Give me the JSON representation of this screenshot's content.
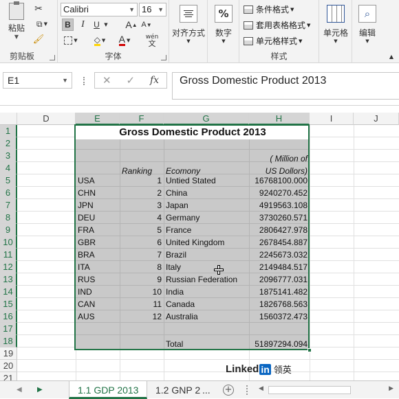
{
  "ribbon": {
    "clipboard": {
      "paste_label": "粘贴",
      "group_label": "剪贴板"
    },
    "font": {
      "font_name": "Calibri",
      "font_size": "16",
      "bold": "B",
      "italic": "I",
      "underline": "U",
      "grow": "A",
      "shrink": "A",
      "font_color": "A",
      "wen": "wén",
      "wen_sub": "文",
      "group_label": "字体"
    },
    "alignment": {
      "label": "对齐方式"
    },
    "number": {
      "label": "数字",
      "icon": "%"
    },
    "styles": {
      "conditional": "条件格式",
      "table": "套用表格格式",
      "cell_styles": "单元格样式",
      "group_label": "样式"
    },
    "cells": {
      "label": "单元格"
    },
    "editing": {
      "label": "编辑"
    }
  },
  "formula_bar": {
    "name_box": "E1",
    "cancel": "✕",
    "enter": "✓",
    "fx": "fx",
    "content": "Gross Domestic Product 2013"
  },
  "columns": [
    "D",
    "E",
    "F",
    "G",
    "H",
    "I",
    "J"
  ],
  "rows": [
    "1",
    "2",
    "3",
    "4",
    "5",
    "6",
    "7",
    "8",
    "9",
    "10",
    "11",
    "12",
    "13",
    "14",
    "15",
    "16",
    "17",
    "18",
    "19",
    "20",
    "21"
  ],
  "sheet": {
    "title": "Gross Domestic Product 2013",
    "unit_line1": "( Million of",
    "unit_line2": "US Dollors)",
    "header_ranking": "Ranking",
    "header_economy": "Ecomony",
    "data": [
      {
        "code": "USA",
        "rank": "1",
        "name": "Untied Stated",
        "value": "16768100.000"
      },
      {
        "code": "CHN",
        "rank": "2",
        "name": "China",
        "value": "9240270.452"
      },
      {
        "code": "JPN",
        "rank": "3",
        "name": "Japan",
        "value": "4919563.108"
      },
      {
        "code": "DEU",
        "rank": "4",
        "name": "Germany",
        "value": "3730260.571"
      },
      {
        "code": "FRA",
        "rank": "5",
        "name": "France",
        "value": "2806427.978"
      },
      {
        "code": "GBR",
        "rank": "6",
        "name": "United Kingdom",
        "value": "2678454.887"
      },
      {
        "code": "BRA",
        "rank": "7",
        "name": "Brazil",
        "value": "2245673.032"
      },
      {
        "code": "ITA",
        "rank": "8",
        "name": "Italy",
        "value": "2149484.517"
      },
      {
        "code": "RUS",
        "rank": "9",
        "name": "Russian Federation",
        "value": "2096777.031"
      },
      {
        "code": "IND",
        "rank": "10",
        "name": "India",
        "value": "1875141.482"
      },
      {
        "code": "CAN",
        "rank": "11",
        "name": "Canada",
        "value": "1826768.563"
      },
      {
        "code": "AUS",
        "rank": "12",
        "name": "Australia",
        "value": "1560372.473"
      }
    ],
    "total_label": "Total",
    "total_value": "51897294.094"
  },
  "tabs": {
    "sheets": [
      "1.1 GDP 2013",
      "1.2 GNP 2("
    ],
    "more": "...",
    "add": "+"
  },
  "watermark": {
    "brand": "Linked",
    "in": "in",
    "cn": "领英"
  },
  "colors": {
    "accent": "#217346",
    "shade": "#c9c9c9"
  }
}
